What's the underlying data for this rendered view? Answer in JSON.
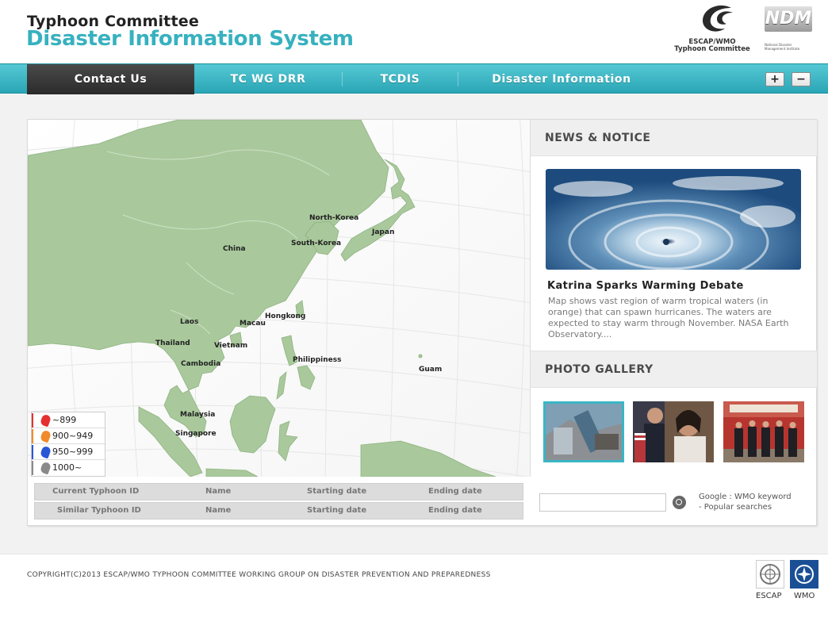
{
  "header": {
    "title_line1": "Typhoon Committee",
    "title_line2": "Disaster Information System",
    "escap_logo_text_1": "ESCAP/WMO",
    "escap_logo_text_2": "Typhoon Committee",
    "ndm_logo_mark": "NDM",
    "ndm_logo_text": "National Disaster Management Institute"
  },
  "nav": {
    "items": [
      {
        "label": "Contact Us",
        "active": true
      },
      {
        "label": "TC WG DRR",
        "active": false
      },
      {
        "label": "TCDIS",
        "active": false
      },
      {
        "label": "Disaster Information",
        "active": false
      }
    ],
    "zoom_in": "+",
    "zoom_out": "−"
  },
  "map": {
    "labels": [
      "North-Korea",
      "Japan",
      "South-Korea",
      "China",
      "Hongkong",
      "Laos",
      "Macau",
      "Thailand",
      "Vietnam",
      "Cambodia",
      "Philippiness",
      "Guam",
      "Malaysia",
      "Singapore"
    ],
    "legend": [
      {
        "label": "~899",
        "color": "#e53030"
      },
      {
        "label": "900~949",
        "color": "#f08a2a"
      },
      {
        "label": "950~999",
        "color": "#2a56d6"
      },
      {
        "label": "1000~",
        "color": "#8a8a8a"
      }
    ]
  },
  "news": {
    "section_title": "NEWS & NOTICE",
    "headline": "Katrina Sparks Warming Debate",
    "body": "Map shows vast region of warm tropical waters (in orange) that can spawn hurricanes. The waters are expected to stay warm through November. NASA Earth Observatory...."
  },
  "gallery": {
    "section_title": "PHOTO GALLERY"
  },
  "typhoon_table": {
    "rows": [
      {
        "id_label": "Current Typhoon ID",
        "name": "Name",
        "start": "Starting date",
        "end": "Ending date"
      },
      {
        "id_label": "Similar Typhoon ID",
        "name": "Name",
        "start": "Starting date",
        "end": "Ending date"
      }
    ]
  },
  "search": {
    "value": "",
    "hint_line1": "Google : WMO keyword",
    "hint_line2": "- Popular searches"
  },
  "footer": {
    "copyright": "COPYRIGHT(C)2013 ESCAP/WMO TYPHOON COMMITTEE WORKING GROUP ON DISASTER PREVENTION AND PREPAREDNESS",
    "logo1_label": "ESCAP",
    "logo2_label": "WMO"
  }
}
